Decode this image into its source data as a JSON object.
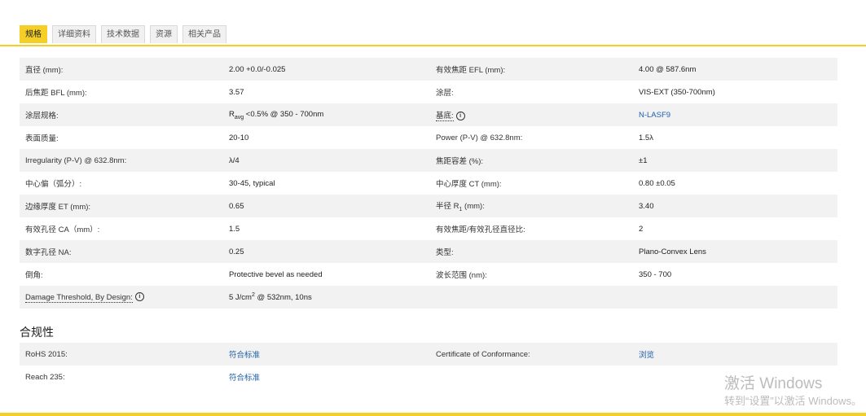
{
  "tabs": [
    {
      "label": "规格",
      "active": true
    },
    {
      "label": "详细资料",
      "active": false
    },
    {
      "label": "技术数据",
      "active": false
    },
    {
      "label": "资源",
      "active": false
    },
    {
      "label": "相关产品",
      "active": false
    }
  ],
  "specs": [
    {
      "l1": "直径 (mm):",
      "v1": "2.00 +0.0/-0.025",
      "l2": "有效焦距 EFL (mm):",
      "v2": "4.00 @ 587.6nm"
    },
    {
      "l1": "后焦距 BFL (mm):",
      "v1": "3.57",
      "l2": "涂层:",
      "v2": "VIS-EXT (350-700nm)"
    },
    {
      "l1": "涂层规格:",
      "v1_pre": "R",
      "v1_sub": "avg",
      "v1_post": " <0.5% @ 350 - 700nm",
      "l2": "基底:",
      "v2": "N-LASF9"
    },
    {
      "l1": "表面质量:",
      "v1": "20-10",
      "l2": "Power (P-V) @ 632.8nm:",
      "v2": "1.5λ"
    },
    {
      "l1": "Irregularity (P-V) @ 632.8nm:",
      "v1": "λ/4",
      "l2": "焦距容差 (%):",
      "v2": "±1"
    },
    {
      "l1": "中心偏（弧分）:",
      "v1": "30-45, typical",
      "l2": "中心厚度 CT (mm):",
      "v2": "0.80 ±0.05"
    },
    {
      "l1": "边缘厚度 ET (mm):",
      "v1": "0.65",
      "l2_pre": "半径 R",
      "l2_sub": "1",
      "l2_post": " (mm):",
      "v2": "3.40"
    },
    {
      "l1": "有效孔径 CA（mm）:",
      "v1": "1.5",
      "l2": "有效焦距/有效孔径直径比:",
      "v2": "2"
    },
    {
      "l1": "数字孔径 NA:",
      "v1": "0.25",
      "l2": "类型:",
      "v2": "Plano-Convex Lens"
    },
    {
      "l1": "倒角:",
      "v1": "Protective bevel as needed",
      "l2": "波长范围 (nm):",
      "v2": "350 - 700"
    },
    {
      "l1": "Damage Threshold, By Design:",
      "v1_pre": "5 J/cm",
      "v1_sup": "2",
      "v1_post": " @ 532nm, 10ns",
      "l2": "",
      "v2": ""
    }
  ],
  "info_icon_glyph": "i",
  "compliance": {
    "title": "合规性",
    "rows": [
      {
        "l1": "RoHS 2015:",
        "v1": "符合标准",
        "l2": "Certificate of Conformance:",
        "v2": "浏览"
      },
      {
        "l1": "Reach 235:",
        "v1": "符合标准",
        "l2": "",
        "v2": ""
      }
    ]
  },
  "watermark": {
    "line1": "激活 Windows",
    "line2": "转到“设置”以激活 Windows。"
  },
  "colors": {
    "accent": "#f5cf26",
    "link": "#1f5fa8",
    "row_alt": "#f2f2f2"
  }
}
